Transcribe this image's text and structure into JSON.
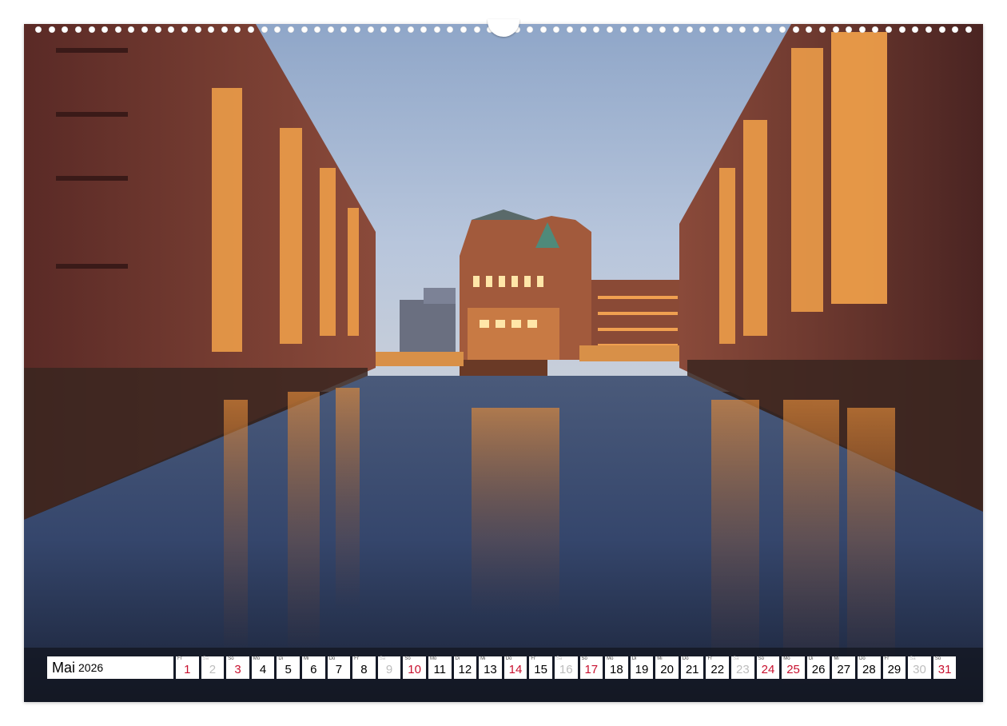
{
  "calendar": {
    "month": "Mai",
    "year": "2026",
    "days": [
      {
        "wd": "Fr",
        "n": "1",
        "type": "hol"
      },
      {
        "wd": "Sa",
        "n": "2",
        "type": "sat"
      },
      {
        "wd": "So",
        "n": "3",
        "type": "sun"
      },
      {
        "wd": "Mo",
        "n": "4",
        "type": "normal"
      },
      {
        "wd": "Di",
        "n": "5",
        "type": "normal"
      },
      {
        "wd": "Mi",
        "n": "6",
        "type": "normal"
      },
      {
        "wd": "Do",
        "n": "7",
        "type": "normal"
      },
      {
        "wd": "Fr",
        "n": "8",
        "type": "normal"
      },
      {
        "wd": "Sa",
        "n": "9",
        "type": "sat"
      },
      {
        "wd": "So",
        "n": "10",
        "type": "sun"
      },
      {
        "wd": "Mo",
        "n": "11",
        "type": "normal"
      },
      {
        "wd": "Di",
        "n": "12",
        "type": "normal"
      },
      {
        "wd": "Mi",
        "n": "13",
        "type": "normal"
      },
      {
        "wd": "Do",
        "n": "14",
        "type": "hol"
      },
      {
        "wd": "Fr",
        "n": "15",
        "type": "normal"
      },
      {
        "wd": "Sa",
        "n": "16",
        "type": "sat"
      },
      {
        "wd": "So",
        "n": "17",
        "type": "sun"
      },
      {
        "wd": "Mo",
        "n": "18",
        "type": "normal"
      },
      {
        "wd": "Di",
        "n": "19",
        "type": "normal"
      },
      {
        "wd": "Mi",
        "n": "20",
        "type": "normal"
      },
      {
        "wd": "Do",
        "n": "21",
        "type": "normal"
      },
      {
        "wd": "Fr",
        "n": "22",
        "type": "normal"
      },
      {
        "wd": "Sa",
        "n": "23",
        "type": "sat"
      },
      {
        "wd": "So",
        "n": "24",
        "type": "sun"
      },
      {
        "wd": "Mo",
        "n": "25",
        "type": "hol"
      },
      {
        "wd": "Di",
        "n": "26",
        "type": "normal"
      },
      {
        "wd": "Mi",
        "n": "27",
        "type": "normal"
      },
      {
        "wd": "Do",
        "n": "28",
        "type": "normal"
      },
      {
        "wd": "Fr",
        "n": "29",
        "type": "normal"
      },
      {
        "wd": "Sa",
        "n": "30",
        "type": "sat"
      },
      {
        "wd": "So",
        "n": "31",
        "type": "sun"
      }
    ]
  },
  "colors": {
    "holiday_red": "#c8102e",
    "weekend_grey": "#bdbdbd"
  }
}
